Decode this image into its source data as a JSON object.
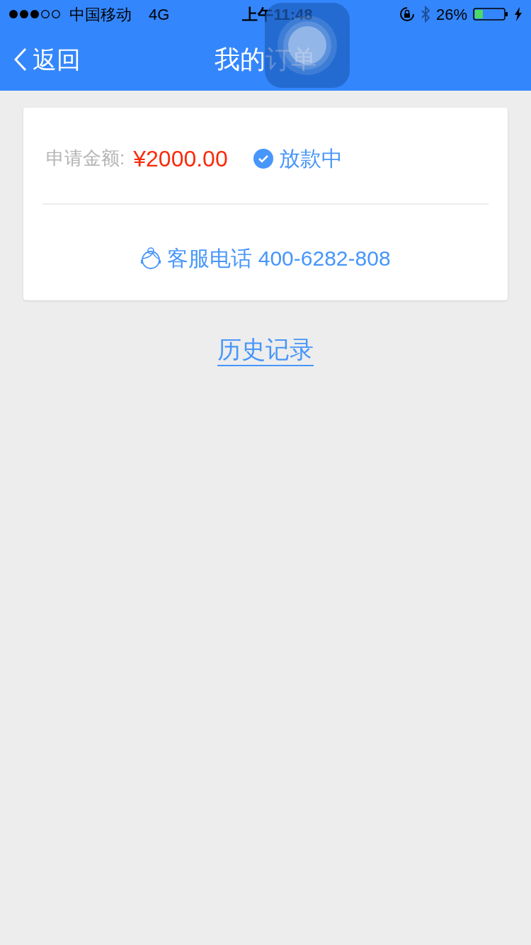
{
  "status_bar": {
    "carrier": "中国移动",
    "network": "4G",
    "time": "上午11:48",
    "battery": "26%"
  },
  "nav_bar": {
    "back": "返回",
    "title": "我的订单"
  },
  "order_card": {
    "amount_label": "申请金额:",
    "amount": "¥2000.00",
    "status": "放款中",
    "hotline": "客服电话 400-6282-808"
  },
  "history_link": "历史记录"
}
